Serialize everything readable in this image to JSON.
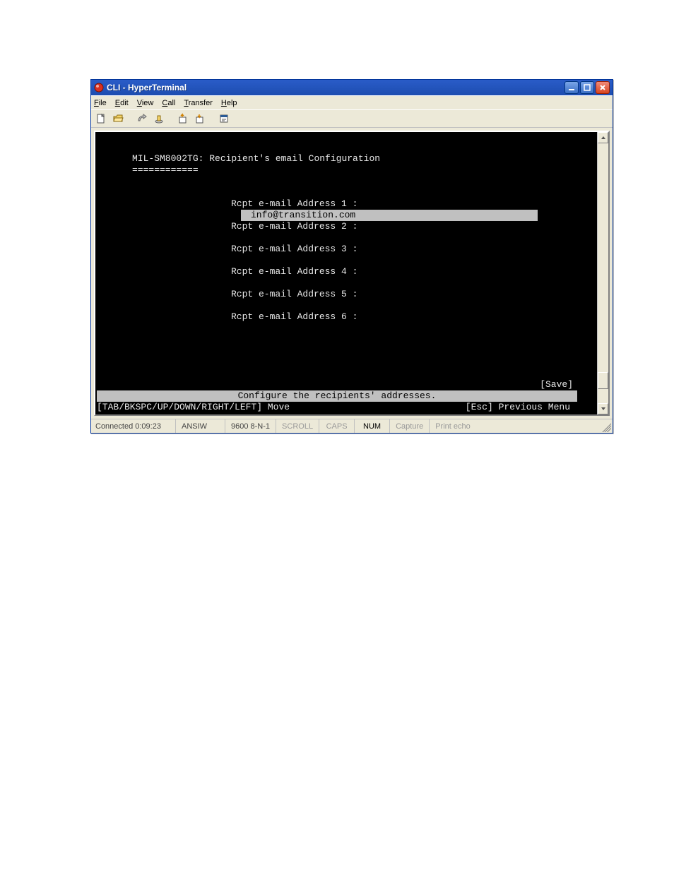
{
  "window": {
    "title": "CLI - HyperTerminal"
  },
  "menu": {
    "file": "File",
    "edit": "Edit",
    "view": "View",
    "call": "Call",
    "transfer": "Transfer",
    "help": "Help"
  },
  "terminal": {
    "header": "MIL-SM8002TG: Recipient's email Configuration",
    "divider": "============",
    "fields": [
      {
        "label": "Rcpt e-mail Address 1 :",
        "value": "info@transition.com",
        "active": true
      },
      {
        "label": "Rcpt e-mail Address 2 :",
        "value": "",
        "active": false
      },
      {
        "label": "Rcpt e-mail Address 3 :",
        "value": "",
        "active": false
      },
      {
        "label": "Rcpt e-mail Address 4 :",
        "value": "",
        "active": false
      },
      {
        "label": "Rcpt e-mail Address 5 :",
        "value": "",
        "active": false
      },
      {
        "label": "Rcpt e-mail Address 6 :",
        "value": "",
        "active": false
      }
    ],
    "save": "[Save]",
    "hint": "Configure the recipients' addresses.",
    "nav_left": "[TAB/BKSPC/UP/DOWN/RIGHT/LEFT] Move",
    "nav_right": "[Esc] Previous Menu"
  },
  "status": {
    "connected": "Connected 0:09:23",
    "emu": "ANSIW",
    "baud": "9600 8-N-1",
    "scroll": "SCROLL",
    "caps": "CAPS",
    "num": "NUM",
    "capture": "Capture",
    "printecho": "Print echo"
  },
  "icons": {
    "min": "minimize",
    "max": "maximize",
    "close": "close"
  }
}
